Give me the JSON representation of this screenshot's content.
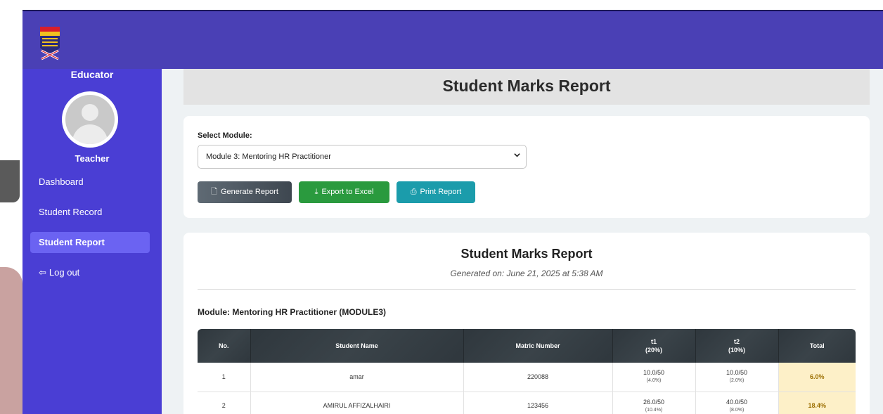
{
  "sidebar": {
    "role_title": "Educator",
    "teacher_name": "Teacher",
    "items": [
      {
        "label": "Dashboard",
        "active": false
      },
      {
        "label": "Student Record",
        "active": false
      },
      {
        "label": "Student Report",
        "active": true
      },
      {
        "label": "Log out",
        "active": false
      }
    ]
  },
  "page": {
    "title": "Student Marks Report"
  },
  "selector": {
    "label": "Select Module:",
    "selected": "Module 3: Mentoring HR Practitioner"
  },
  "buttons": {
    "generate": "Generate Report",
    "export": "Export to Excel",
    "print": "Print Report"
  },
  "report": {
    "title": "Student Marks Report",
    "generated": "Generated on: June 21, 2025 at 5:38 AM",
    "module": "Module: Mentoring HR Practitioner (MODULE3)",
    "columns": [
      "No.",
      "Student Name",
      "Matric Number",
      "t1",
      "(20%)",
      "t2",
      "(10%)",
      "Total"
    ],
    "rows": [
      {
        "no": "1",
        "name": "amar",
        "matric": "220088",
        "t1": "10.0/50",
        "t1_pct": "(4.0%)",
        "t2": "10.0/50",
        "t2_pct": "(2.0%)",
        "total": "6.0%"
      },
      {
        "no": "2",
        "name": "AMIRUL AFFIZALHAIRI",
        "matric": "123456",
        "t1": "26.0/50",
        "t1_pct": "(10.4%)",
        "t2": "40.0/50",
        "t2_pct": "(8.0%)",
        "total": "18.4%"
      }
    ]
  },
  "colors": {
    "header_bg": "#4a40b5",
    "sidebar_bg": "#4a3ed4",
    "active_nav": "#6b63f2",
    "excel_btn": "#2a9a3e",
    "print_btn": "#1b9cab",
    "total_cell": "#fdf0c8"
  }
}
